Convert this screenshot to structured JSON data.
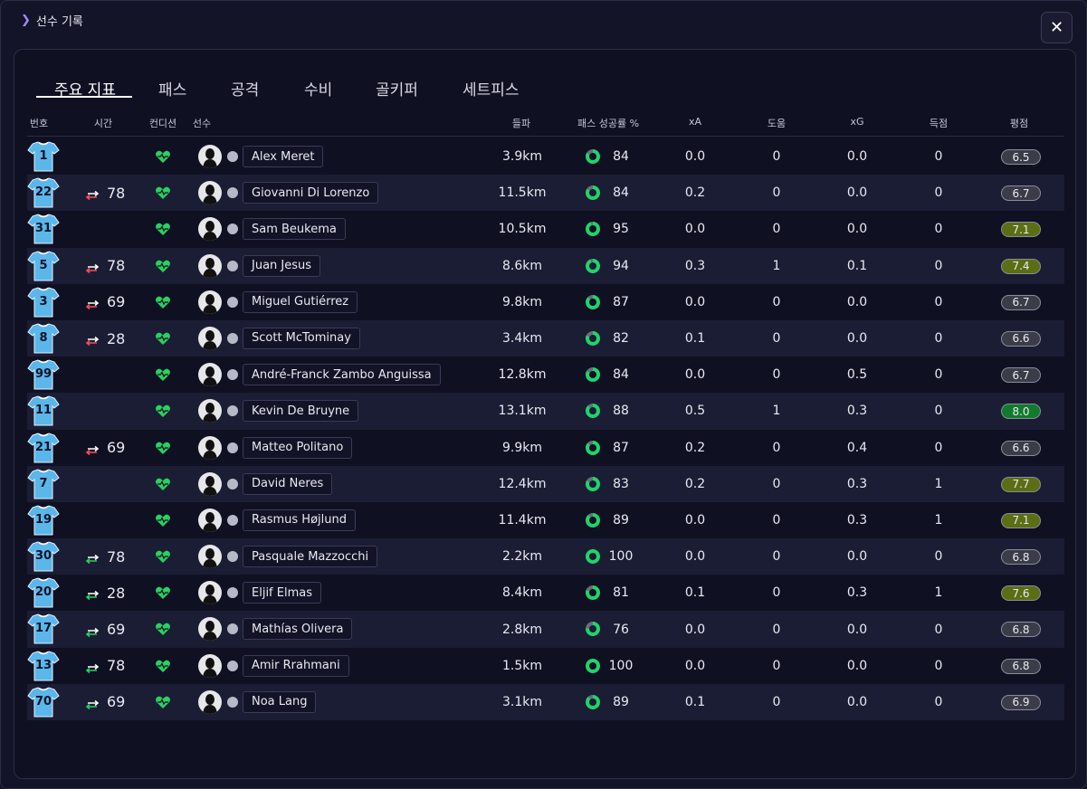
{
  "window": {
    "title": "선수 기록",
    "close_glyph": "✕"
  },
  "tabs": [
    {
      "label": "주요 지표",
      "active": true
    },
    {
      "label": "패스",
      "active": false
    },
    {
      "label": "공격",
      "active": false
    },
    {
      "label": "수비",
      "active": false
    },
    {
      "label": "골키퍼",
      "active": false
    },
    {
      "label": "세트피스",
      "active": false
    }
  ],
  "columns": {
    "number": "번호",
    "time": "시간",
    "condition": "컨디션",
    "player": "선수",
    "distance": "들파",
    "pass_rate": "패스 성공률 %",
    "xa": "xA",
    "assists": "도움",
    "xg": "xG",
    "goals": "득점",
    "rating": "평점"
  },
  "colors": {
    "accent": "#a58bff",
    "ring_green": "#1fd46a",
    "heart_green": "#29d160",
    "sub_out_red": "#ff4d5a",
    "sub_in_green": "#29d160",
    "rating_gray": "#3a3c47",
    "rating_olive": "#5b6e14",
    "rating_green": "#127a2c",
    "shirt_blue": "#5bb6ea"
  },
  "players": [
    {
      "number": "1",
      "sub_type": "",
      "minute": "",
      "name": "Alex Meret",
      "distance": "3.9km",
      "pass_rate": "84",
      "pass_frac": 0.84,
      "xa": "0.0",
      "assists": "0",
      "xg": "0.0",
      "goals": "0",
      "rating": "6.5",
      "rating_tier": "gray"
    },
    {
      "number": "22",
      "sub_type": "out",
      "minute": "78",
      "name": "Giovanni Di Lorenzo",
      "distance": "11.5km",
      "pass_rate": "84",
      "pass_frac": 0.84,
      "xa": "0.2",
      "assists": "0",
      "xg": "0.0",
      "goals": "0",
      "rating": "6.7",
      "rating_tier": "gray"
    },
    {
      "number": "31",
      "sub_type": "",
      "minute": "",
      "name": "Sam Beukema",
      "distance": "10.5km",
      "pass_rate": "95",
      "pass_frac": 0.95,
      "xa": "0.0",
      "assists": "0",
      "xg": "0.0",
      "goals": "0",
      "rating": "7.1",
      "rating_tier": "olive"
    },
    {
      "number": "5",
      "sub_type": "out",
      "minute": "78",
      "name": "Juan Jesus",
      "distance": "8.6km",
      "pass_rate": "94",
      "pass_frac": 0.94,
      "xa": "0.3",
      "assists": "1",
      "xg": "0.1",
      "goals": "0",
      "rating": "7.4",
      "rating_tier": "olive"
    },
    {
      "number": "3",
      "sub_type": "out",
      "minute": "69",
      "name": "Miguel Gutiérrez",
      "distance": "9.8km",
      "pass_rate": "87",
      "pass_frac": 0.87,
      "xa": "0.0",
      "assists": "0",
      "xg": "0.0",
      "goals": "0",
      "rating": "6.7",
      "rating_tier": "gray"
    },
    {
      "number": "8",
      "sub_type": "out",
      "minute": "28",
      "name": "Scott McTominay",
      "distance": "3.4km",
      "pass_rate": "82",
      "pass_frac": 0.82,
      "xa": "0.1",
      "assists": "0",
      "xg": "0.0",
      "goals": "0",
      "rating": "6.6",
      "rating_tier": "gray"
    },
    {
      "number": "99",
      "sub_type": "",
      "minute": "",
      "name": "André-Franck Zambo Anguissa",
      "distance": "12.8km",
      "pass_rate": "84",
      "pass_frac": 0.84,
      "xa": "0.0",
      "assists": "0",
      "xg": "0.5",
      "goals": "0",
      "rating": "6.7",
      "rating_tier": "gray"
    },
    {
      "number": "11",
      "sub_type": "",
      "minute": "",
      "name": "Kevin De Bruyne",
      "distance": "13.1km",
      "pass_rate": "88",
      "pass_frac": 0.88,
      "xa": "0.5",
      "assists": "1",
      "xg": "0.3",
      "goals": "0",
      "rating": "8.0",
      "rating_tier": "green"
    },
    {
      "number": "21",
      "sub_type": "out",
      "minute": "69",
      "name": "Matteo Politano",
      "distance": "9.9km",
      "pass_rate": "87",
      "pass_frac": 0.87,
      "xa": "0.2",
      "assists": "0",
      "xg": "0.4",
      "goals": "0",
      "rating": "6.6",
      "rating_tier": "gray"
    },
    {
      "number": "7",
      "sub_type": "",
      "minute": "",
      "name": "David Neres",
      "distance": "12.4km",
      "pass_rate": "83",
      "pass_frac": 0.83,
      "xa": "0.2",
      "assists": "0",
      "xg": "0.3",
      "goals": "1",
      "rating": "7.7",
      "rating_tier": "olive"
    },
    {
      "number": "19",
      "sub_type": "",
      "minute": "",
      "name": "Rasmus Højlund",
      "distance": "11.4km",
      "pass_rate": "89",
      "pass_frac": 0.89,
      "xa": "0.0",
      "assists": "0",
      "xg": "0.3",
      "goals": "1",
      "rating": "7.1",
      "rating_tier": "olive"
    },
    {
      "number": "30",
      "sub_type": "in",
      "minute": "78",
      "name": "Pasquale Mazzocchi",
      "distance": "2.2km",
      "pass_rate": "100",
      "pass_frac": 1.0,
      "xa": "0.0",
      "assists": "0",
      "xg": "0.0",
      "goals": "0",
      "rating": "6.8",
      "rating_tier": "gray"
    },
    {
      "number": "20",
      "sub_type": "in",
      "minute": "28",
      "name": "Eljif Elmas",
      "distance": "8.4km",
      "pass_rate": "81",
      "pass_frac": 0.81,
      "xa": "0.1",
      "assists": "0",
      "xg": "0.3",
      "goals": "1",
      "rating": "7.6",
      "rating_tier": "olive"
    },
    {
      "number": "17",
      "sub_type": "in",
      "minute": "69",
      "name": "Mathías Olivera",
      "distance": "2.8km",
      "pass_rate": "76",
      "pass_frac": 0.76,
      "xa": "0.0",
      "assists": "0",
      "xg": "0.0",
      "goals": "0",
      "rating": "6.8",
      "rating_tier": "gray"
    },
    {
      "number": "13",
      "sub_type": "in",
      "minute": "78",
      "name": "Amir Rrahmani",
      "distance": "1.5km",
      "pass_rate": "100",
      "pass_frac": 1.0,
      "xa": "0.0",
      "assists": "0",
      "xg": "0.0",
      "goals": "0",
      "rating": "6.8",
      "rating_tier": "gray"
    },
    {
      "number": "70",
      "sub_type": "in",
      "minute": "69",
      "name": "Noa Lang",
      "distance": "3.1km",
      "pass_rate": "89",
      "pass_frac": 0.89,
      "xa": "0.1",
      "assists": "0",
      "xg": "0.0",
      "goals": "0",
      "rating": "6.9",
      "rating_tier": "gray"
    }
  ]
}
